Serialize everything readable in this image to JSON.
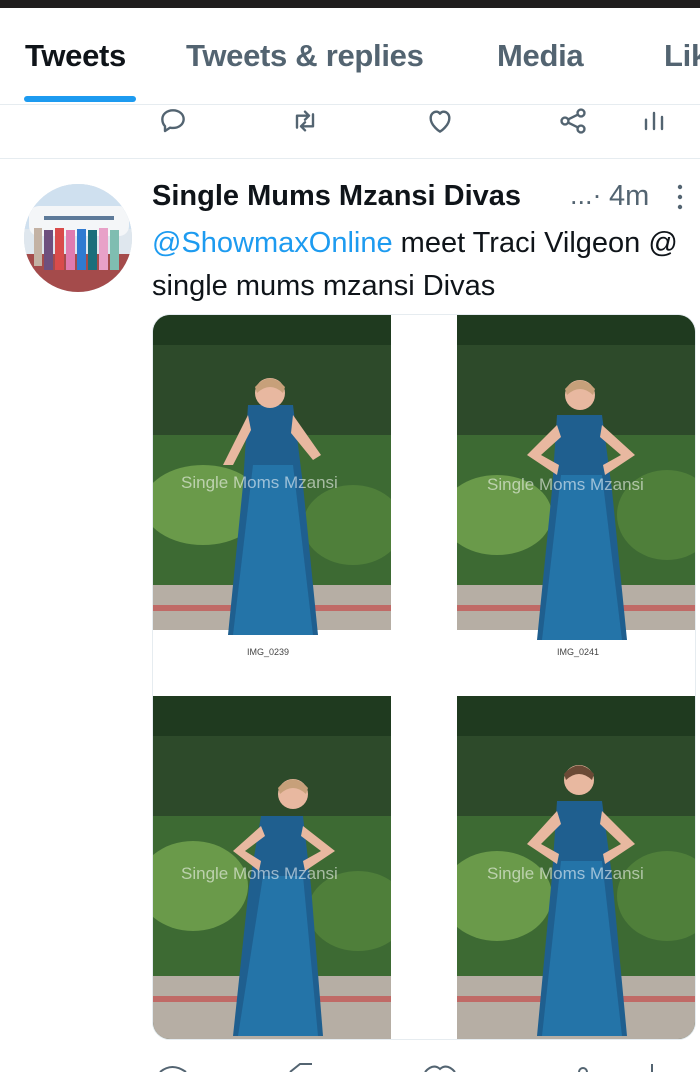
{
  "tabs": [
    {
      "label": "Tweets",
      "active": true
    },
    {
      "label": "Tweets & replies",
      "active": false
    },
    {
      "label": "Media",
      "active": false
    },
    {
      "label": "Lik",
      "active": false
    }
  ],
  "colors": {
    "accent": "#1d9bf0",
    "text": "#0f1419",
    "muted": "#536471"
  },
  "tweet": {
    "author_name": "Single Mums Mzansi Divas",
    "ellipsis": "...·",
    "time": "4m",
    "mention": "@ShowmaxOnline",
    "text_rest": " meet Traci Vilgeon @ single mums mzansi Divas",
    "photos": [
      {
        "caption": "IMG_0239",
        "watermark": "Single Moms Mzansi"
      },
      {
        "caption": "IMG_0241",
        "watermark": "Single Moms Mzansi"
      },
      {
        "caption": "",
        "watermark": "Single Moms Mzansi"
      },
      {
        "caption": "",
        "watermark": "Single Moms Mzansi"
      }
    ]
  },
  "actions": [
    "reply-icon",
    "retweet-icon",
    "like-icon",
    "share-icon",
    "analytics-icon"
  ]
}
